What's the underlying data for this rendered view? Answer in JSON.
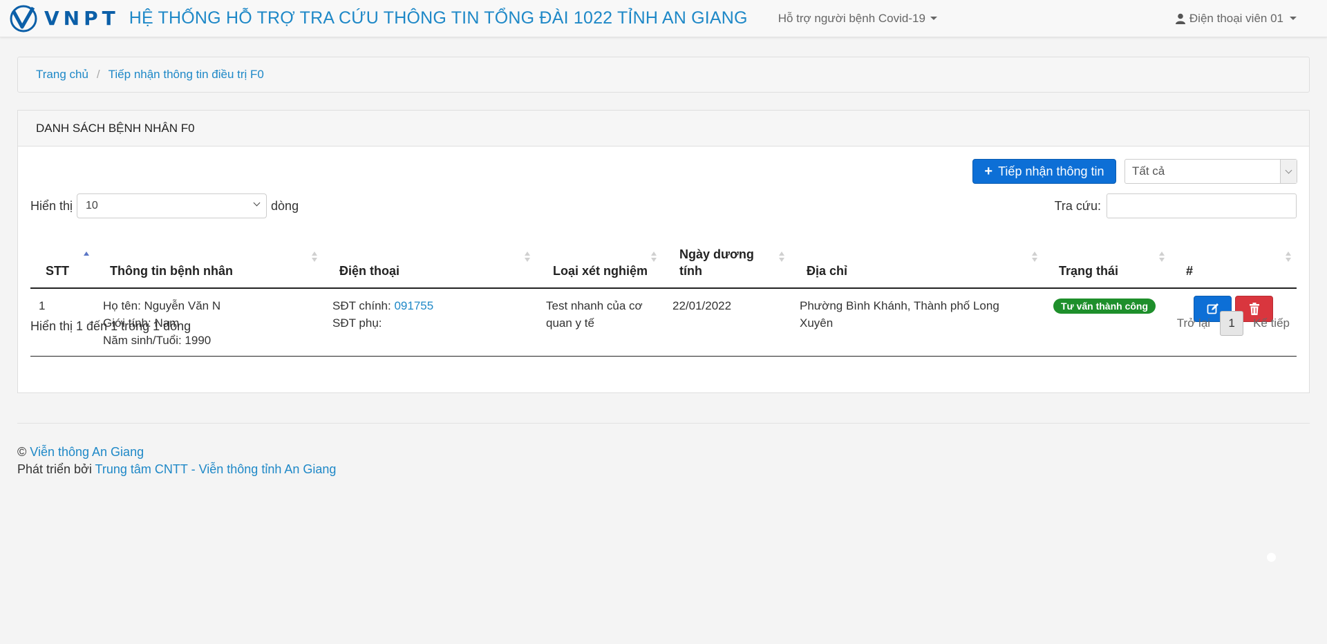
{
  "navbar": {
    "logo_text": "VNPT",
    "app_title": "HỆ THỐNG HỖ TRỢ TRA CỨU THÔNG TIN TỔNG ĐÀI 1022 TỈNH AN GIANG",
    "menu_label": "Hỗ trợ người bệnh Covid-19",
    "user_label": "Điện thoại viên 01"
  },
  "breadcrumb": {
    "home": "Trang chủ",
    "current": "Tiếp nhận thông tin điều trị F0"
  },
  "panel": {
    "title": "DANH SÁCH BỆNH NHÂN F0",
    "add_button": "Tiếp nhận thông tin",
    "status_filter": "Tất cả",
    "show_label": "Hiển thị",
    "page_length": "10",
    "rows_label": "dòng",
    "search_label": "Tra cứu:",
    "search_value": ""
  },
  "table": {
    "headers": {
      "stt": "STT",
      "patient": "Thông tin bệnh nhân",
      "phone": "Điện thoại",
      "test_type": "Loại xét nghiệm",
      "positive_date_1": "Ngày dương",
      "positive_date_2": "tính",
      "address": "Địa chỉ",
      "status": "Trạng thái",
      "actions": "#"
    },
    "rows": [
      {
        "stt": "1",
        "name": "Họ tên: Nguyễn Văn N",
        "gender": "Giới tính: Nam",
        "birth": "Năm sinh/Tuổi: 1990",
        "phone_main_label": "SĐT chính:",
        "phone_main": "091755",
        "phone_sub_label": "SĐT phụ:",
        "test_type_1": "Test nhanh của cơ",
        "test_type_2": "quan y tế",
        "positive_date": "22/01/2022",
        "address_1": "Phường Bình Khánh, Thành phố Long",
        "address_2": "Xuyên",
        "status": "Tư vấn thành công"
      }
    ],
    "info": "Hiển thị 1 đến 1 trong 1 dòng",
    "prev": "Trở lại",
    "page": "1",
    "next": "Kế tiếp"
  },
  "footer": {
    "copyright_symbol": "©",
    "org_link": "Viễn thông An Giang",
    "dev_prefix": "Phát triển bởi",
    "dev_link": "Trung tâm CNTT - Viễn thông tỉnh An Giang"
  },
  "colors": {
    "brand": "#1e88c7",
    "primary_button": "#0d6fd6",
    "danger_button": "#d9363e",
    "success_badge": "#1e8f2b"
  }
}
